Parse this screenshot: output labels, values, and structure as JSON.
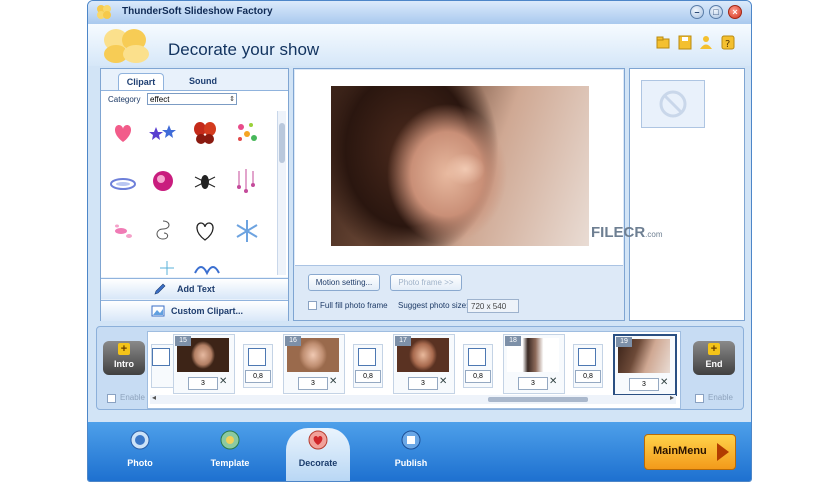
{
  "window": {
    "title": "ThunderSoft Slideshow Factory"
  },
  "header": {
    "heading": "Decorate your show"
  },
  "left_panel": {
    "tabs": [
      {
        "label": "Clipart"
      },
      {
        "label": "Sound"
      }
    ],
    "category_label": "Category",
    "category_value": "effect",
    "add_text_label": "Add Text",
    "custom_clipart_label": "Custom Clipart..."
  },
  "center_panel": {
    "motion_setting_label": "Motion setting...",
    "photo_frame_label": "Photo frame >>",
    "full_fill_label": "Full fill photo frame",
    "suggest_size_label": "Suggest photo size:",
    "suggest_size_value": "720 x 540"
  },
  "timeline": {
    "intro_label": "Intro",
    "end_label": "End",
    "enable_label": "Enable",
    "frames": [
      {
        "num": "15",
        "duration": "3"
      },
      {
        "num": "16",
        "duration": "3"
      },
      {
        "num": "17",
        "duration": "3"
      },
      {
        "num": "18",
        "duration": "3"
      },
      {
        "num": "19",
        "duration": "3"
      }
    ],
    "transitions": [
      {
        "value": "0,8"
      },
      {
        "value": "0,8"
      },
      {
        "value": "0,8"
      },
      {
        "value": "0,8"
      }
    ]
  },
  "bottom_nav": {
    "items": [
      {
        "label": "Photo"
      },
      {
        "label": "Template"
      },
      {
        "label": "Decorate"
      },
      {
        "label": "Publish"
      }
    ],
    "main_menu_label": "MainMenu"
  },
  "watermark": {
    "brand": "FILECR",
    "suffix": ".com"
  },
  "colors": {
    "accent": "#1c6fcf",
    "main_menu": "#f39a1a",
    "panel": "#d2e4f6"
  }
}
